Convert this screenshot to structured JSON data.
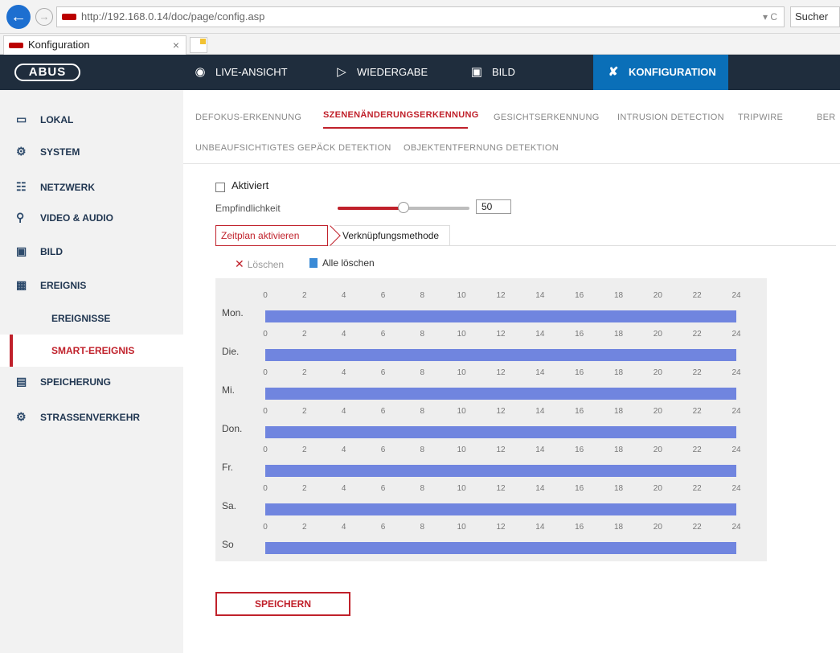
{
  "browser": {
    "url": "http://192.168.0.14/doc/page/config.asp",
    "search_placeholder": "Sucher",
    "tab_title": "Konfiguration",
    "tab_close": "×",
    "url_tools": "▾ C"
  },
  "brand": {
    "logo": "ABUS"
  },
  "nav": [
    {
      "label": "LIVE-ANSICHT",
      "icon": "eye-icon"
    },
    {
      "label": "WIEDERGABE",
      "icon": "play-icon"
    },
    {
      "label": "BILD",
      "icon": "image-icon"
    },
    {
      "label": "KONFIGURATION",
      "icon": "tools-icon",
      "active": true
    }
  ],
  "sidebar": [
    {
      "label": "LOKAL",
      "icon": "monitor-icon"
    },
    {
      "label": "SYSTEM",
      "icon": "system-icon"
    },
    {
      "label": "NETZWERK",
      "icon": "network-icon"
    },
    {
      "label": "VIDEO & AUDIO",
      "icon": "microphone-icon"
    },
    {
      "label": "BILD",
      "icon": "image-icon"
    },
    {
      "label": "EREIGNIS",
      "icon": "calendar-icon"
    },
    {
      "label": "EREIGNISSE",
      "sub": true
    },
    {
      "label": "SMART-EREIGNIS",
      "sub": true,
      "active": true
    },
    {
      "label": "SPEICHERUNG",
      "icon": "floppy-icon"
    },
    {
      "label": "STRAßENVERKEHR",
      "icon": "traffic-icon"
    }
  ],
  "subtabs": {
    "row1": [
      "DEFOKUS-ERKENNUNG",
      "SZENENÄNDERUNGSERKENNUNG",
      "GESICHTSERKENNUNG",
      "INTRUSION DETECTION",
      "TRIPWIRE",
      "BER"
    ],
    "row2": [
      "UNBEAUFSICHTIGTES GEPÄCK DETEKTION",
      "OBJEKTENTFERNUNG DETEKTION"
    ]
  },
  "form": {
    "enable_label": "Aktiviert",
    "sensitivity_label": "Empfindlichkeit",
    "sensitivity_value": "50",
    "sensitivity_fraction": 0.5
  },
  "steps": {
    "schedule": "Zeitplan aktivieren",
    "linkage": "Verknüpfungsmethode"
  },
  "actions": {
    "delete": "Löschen",
    "delete_all": "Alle löschen",
    "save": "SPEICHERN"
  },
  "schedule": {
    "ticks": [
      "0",
      "2",
      "4",
      "6",
      "8",
      "10",
      "12",
      "14",
      "16",
      "18",
      "20",
      "22",
      "24"
    ],
    "days": [
      "Mon.",
      "Die.",
      "Mi.",
      "Don.",
      "Fr.",
      "Sa.",
      "So"
    ],
    "bar_color": "#7085df"
  },
  "colors": {
    "accent": "#c0212b",
    "nav_bg": "#1f2d3d",
    "nav_active": "#0a6fb8"
  }
}
